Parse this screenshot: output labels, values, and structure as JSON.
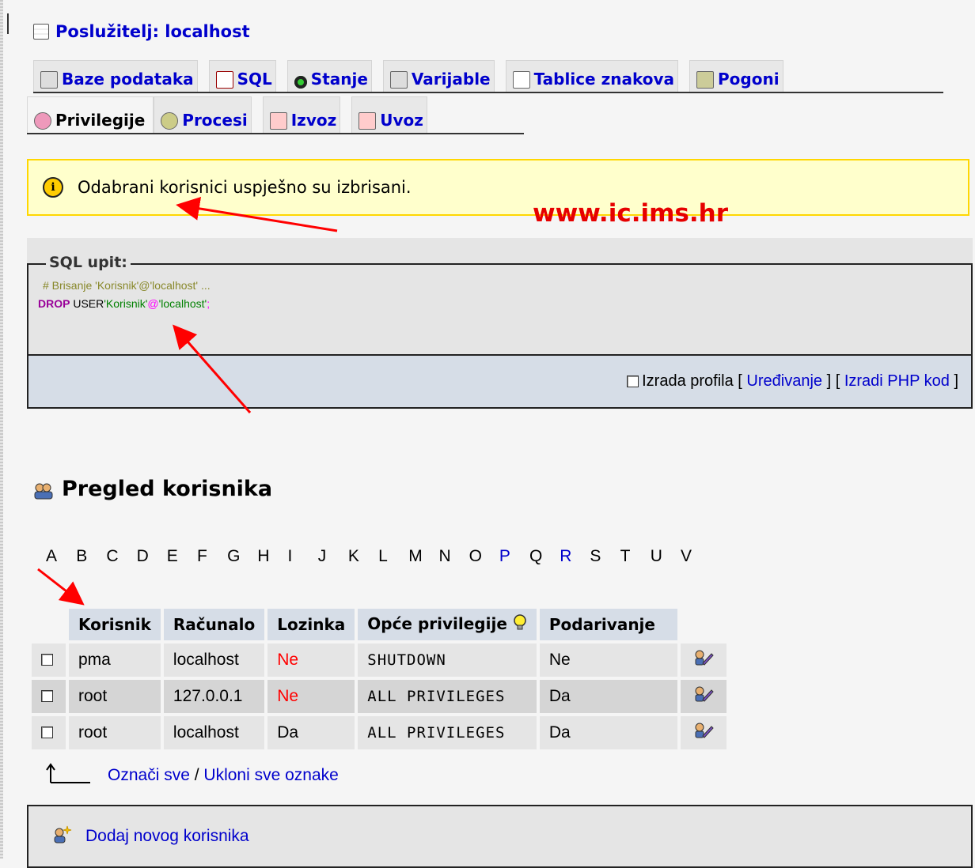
{
  "server": {
    "label": "Poslužitelj: localhost"
  },
  "tabs_row1": [
    {
      "label": "Baze podataka",
      "icon": "database-icon"
    },
    {
      "label": "SQL",
      "icon": "sql-icon"
    },
    {
      "label": "Stanje",
      "icon": "traffic-light-icon"
    },
    {
      "label": "Varijable",
      "icon": "variables-icon"
    },
    {
      "label": "Tablice znakova",
      "icon": "charset-icon"
    },
    {
      "label": "Pogoni",
      "icon": "engines-icon"
    }
  ],
  "tabs_row2": [
    {
      "label": "Privilegije",
      "icon": "privileges-icon",
      "active": true
    },
    {
      "label": "Procesi",
      "icon": "processes-icon"
    },
    {
      "label": "Izvoz",
      "icon": "export-icon"
    },
    {
      "label": "Uvoz",
      "icon": "import-icon"
    }
  ],
  "notice": {
    "icon": "info-icon",
    "icon_glyph": "i",
    "text": "Odabrani korisnici uspješno su izbrisani."
  },
  "watermark": "www.ic.ims.hr",
  "sql": {
    "legend": "SQL upit:",
    "comment": "# Brisanje 'Korisnik'@'localhost' ...",
    "keyword": "DROP",
    "plain": "USER",
    "user_literal": "'Korisnik'",
    "at": "@",
    "host_literal": "'localhost'",
    "terminator": ";",
    "profiling_label": "Izrada profila",
    "bracket_open": "[",
    "bracket_close": "]",
    "edit_link": "Uređivanje",
    "php_link": "Izradi PHP kod"
  },
  "users_section": {
    "title": "Pregled korisnika",
    "icon": "users-icon"
  },
  "alphabet": [
    {
      "letter": "A",
      "link": false
    },
    {
      "letter": "B",
      "link": false
    },
    {
      "letter": "C",
      "link": false
    },
    {
      "letter": "D",
      "link": false
    },
    {
      "letter": "E",
      "link": false
    },
    {
      "letter": "F",
      "link": false
    },
    {
      "letter": "G",
      "link": false
    },
    {
      "letter": "H",
      "link": false
    },
    {
      "letter": "I",
      "link": false
    },
    {
      "letter": "J",
      "link": false
    },
    {
      "letter": "K",
      "link": false
    },
    {
      "letter": "L",
      "link": false
    },
    {
      "letter": "M",
      "link": false
    },
    {
      "letter": "N",
      "link": false
    },
    {
      "letter": "O",
      "link": false
    },
    {
      "letter": "P",
      "link": true
    },
    {
      "letter": "Q",
      "link": false
    },
    {
      "letter": "R",
      "link": true
    },
    {
      "letter": "S",
      "link": false
    },
    {
      "letter": "T",
      "link": false
    },
    {
      "letter": "U",
      "link": false
    },
    {
      "letter": "V",
      "link": false
    }
  ],
  "table": {
    "headers": [
      "Korisnik",
      "Računalo",
      "Lozinka",
      "Opće privilegije",
      "Podarivanje"
    ],
    "rows": [
      {
        "user": "pma",
        "host": "localhost",
        "password": "Ne",
        "privileges": "SHUTDOWN",
        "grant": "Ne"
      },
      {
        "user": "root",
        "host": "127.0.0.1",
        "password": "Ne",
        "privileges": "ALL PRIVILEGES",
        "grant": "Da"
      },
      {
        "user": "root",
        "host": "localhost",
        "password": "Da",
        "privileges": "ALL PRIVILEGES",
        "grant": "Da"
      }
    ]
  },
  "check_all": {
    "check": "Označi sve",
    "separator": "/",
    "uncheck": "Ukloni sve oznake"
  },
  "add_user": {
    "label": "Dodaj novog korisnika",
    "icon": "add-user-icon"
  },
  "colors": {
    "link": "#0000cc",
    "notice_bg": "#ffffcc",
    "notice_border": "#ffd700",
    "header_bg": "#d6dde7",
    "watermark": "#e60000",
    "annotation_arrow": "#ff0000"
  }
}
